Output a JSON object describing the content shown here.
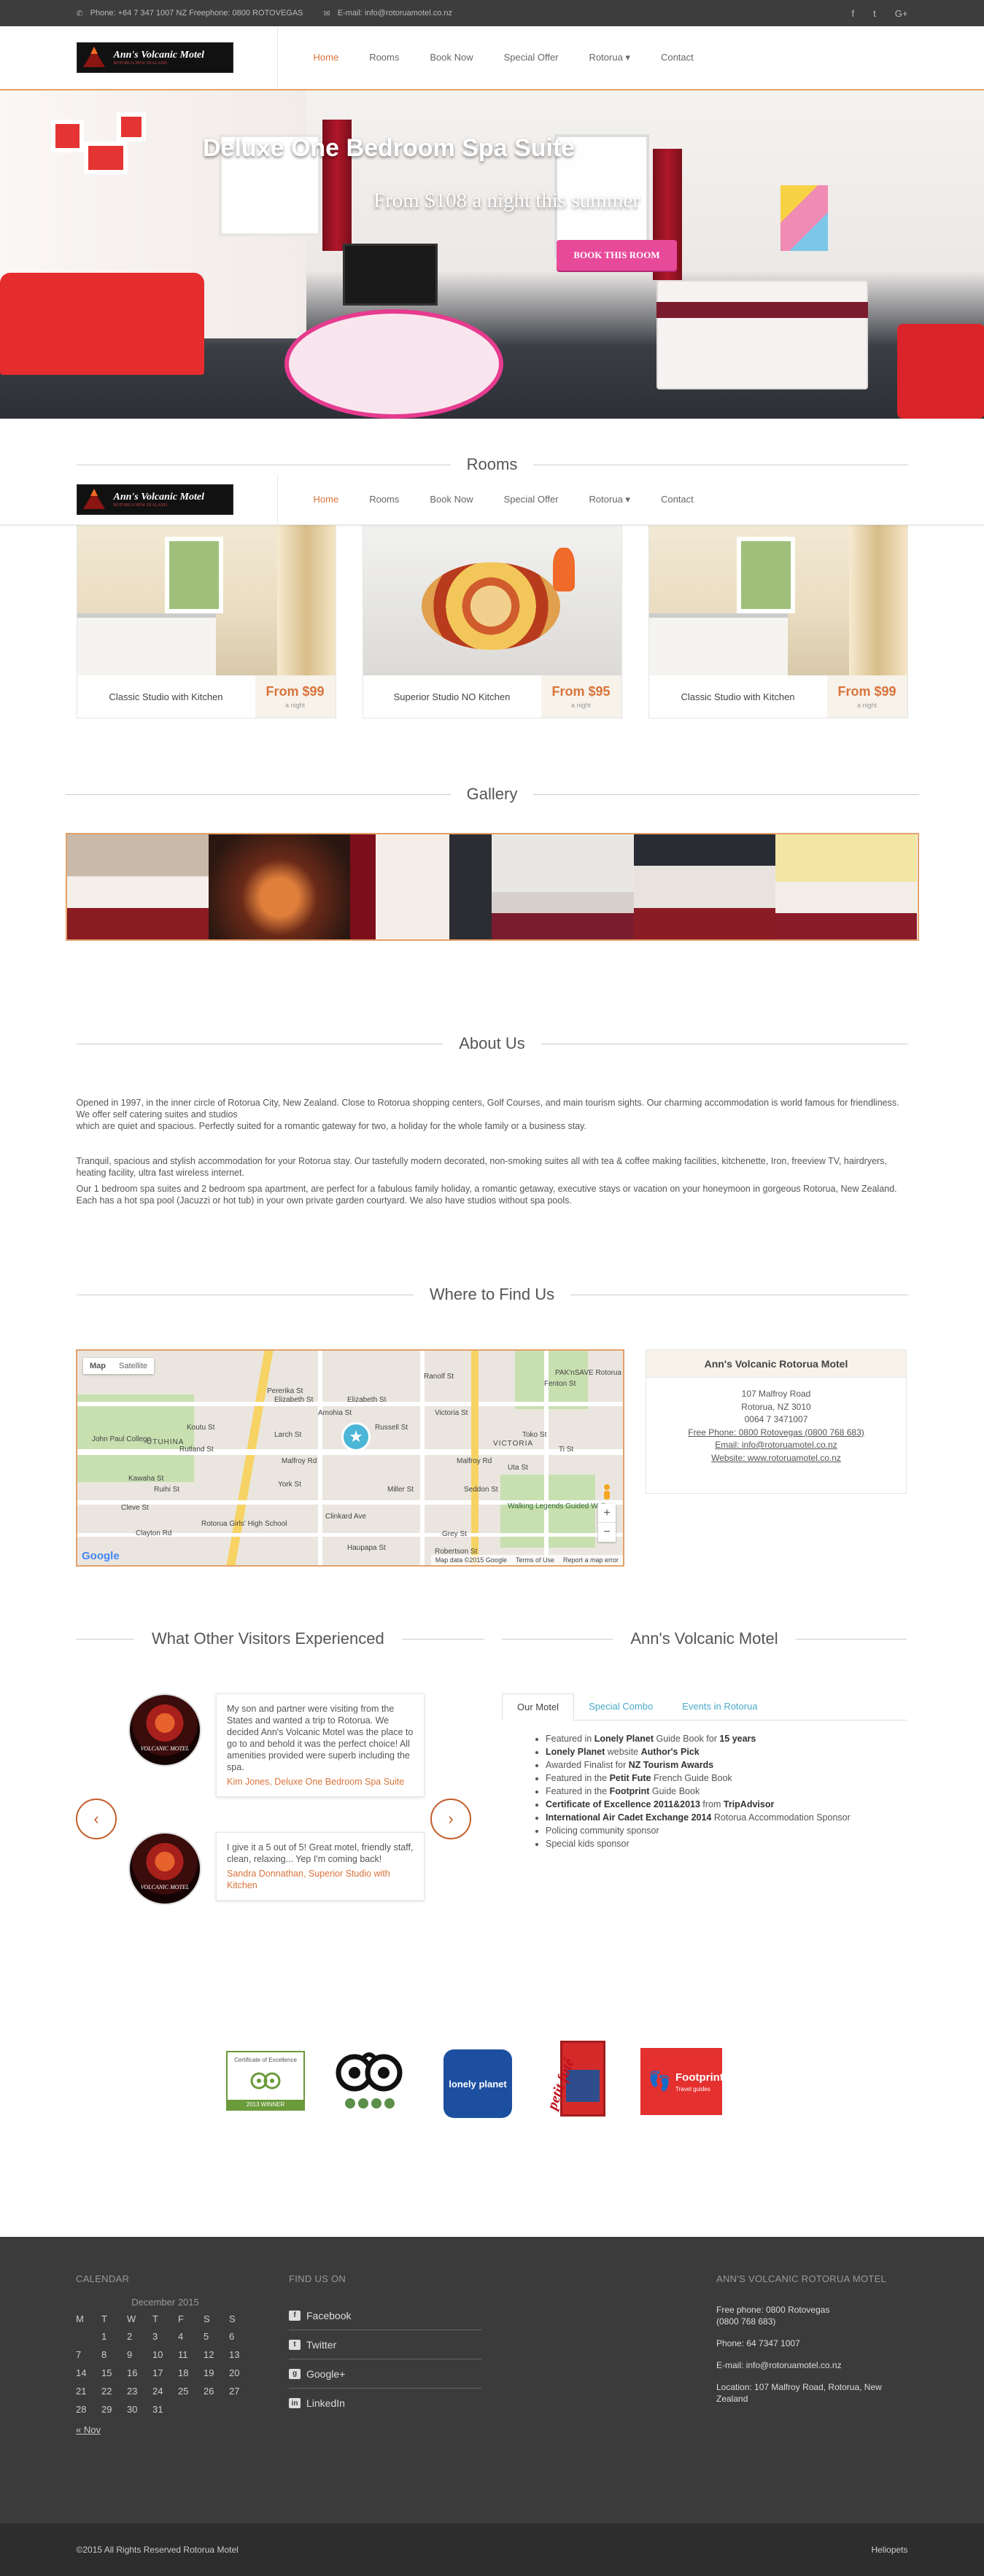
{
  "topbar": {
    "phone": "Phone: +64 7 347 1007 NZ Freephone: 0800 ROTOVEGAS",
    "email": "E-mail: info@rotoruamotel.co.nz",
    "social": [
      "f",
      "t",
      "G+"
    ]
  },
  "brand": {
    "name": "Ann's Volcanic Motel",
    "tagline": "ROTORUA NEW ZEALAND"
  },
  "nav": {
    "items": [
      "Home",
      "Rooms",
      "Book Now",
      "Special Offer",
      "Rotorua",
      "Contact"
    ],
    "dropdown_caret": "▾"
  },
  "hero": {
    "title": "Deluxe One Bedroom Spa Suite",
    "subtitle": "From $108 a night this summer",
    "button": "BOOK THIS ROOM"
  },
  "rooms": {
    "title": "Rooms",
    "cards": [
      {
        "name": "Classic Studio with Kitchen",
        "price": "From $99",
        "per": "a night"
      },
      {
        "name": "Superior Studio NO Kitchen",
        "price": "From $95",
        "per": "a night"
      },
      {
        "name": "Classic Studio with Kitchen",
        "price": "From $99",
        "per": "a night"
      }
    ]
  },
  "gallery": {
    "title": "Gallery"
  },
  "about": {
    "title": "About Us",
    "p1": "Opened in 1997, in the inner circle of Rotorua City, New Zealand. Close to Rotorua shopping centers, Golf Courses, and main tourism sights. Our charming accommodation is world famous for friendliness. We offer self catering suites and studios",
    "p1b": "which are quiet and spacious. Perfectly suited for a romantic gateway for two, a holiday for the whole family or a business stay.",
    "p2": "Tranquil, spacious and stylish accommodation for your Rotorua stay. Our tastefully modern decorated, non-smoking suites all with tea & coffee making facilities, kitchenette, Iron, freeview TV, hairdryers, heating facility, ultra fast wireless internet.",
    "p3": "Our 1 bedroom spa suites and 2 bedroom spa apartment, are perfect for a fabulous family holiday, a romantic getaway, executive stays or vacation on your honeymoon in gorgeous Rotorua, New Zealand. Each has a hot spa pool (Jacuzzi or hot tub) in your own private garden courtyard. We also have studios without spa pools."
  },
  "findus": {
    "title": "Where to Find Us",
    "map": {
      "type_map": "Map",
      "type_satellite": "Satellite",
      "labels": [
        "Pererika St",
        "Elizabeth St",
        "Elizabeth St",
        "Larch St",
        "Rutland St",
        "Malfroy Rd",
        "Malfroy Rd",
        "York St",
        "Clinkard Ave",
        "Seddon St",
        "Grey St",
        "Victoria St",
        "Haupapa St",
        "Ranolf St",
        "Amohia St",
        "Rotorua Girls' High School",
        "UTUHINA",
        "VICTORIA",
        "Walking Legends Guided Walks",
        "PAK'nSAVE Rotorua",
        "Koutu St",
        "Russell St",
        "Kawaha St",
        "John Paul College",
        "Ruihi St",
        "Robertson St",
        "Fenton St",
        "Toko St",
        "Ti St",
        "Miller St",
        "Uta St",
        "Cleve St",
        "Clayton Rd"
      ],
      "zoom_in": "+",
      "zoom_out": "−",
      "google": "Google",
      "footer": [
        "Map data ©2015 Google",
        "Terms of Use",
        "Report a map error"
      ]
    },
    "card": {
      "title": "Ann's Volcanic Rotorua Motel",
      "address1": "107 Malfroy Road",
      "address2": "Rotorua, NZ 3010",
      "phone": "0064 7 3471007",
      "freephone": "Free Phone: 0800 Rotovegas (0800 768 683)",
      "email": "Email: info@rotoruamotel.co.nz",
      "website": "Website: www.rotoruamotel.co.nz"
    }
  },
  "visitors": {
    "title": "What Other Visitors Experienced",
    "avatar_text": "VOLCANIC MOTEL",
    "testimonials": [
      {
        "text": "My son and partner were visiting from the States and wanted a trip to Rotorua. We decided Ann's Volcanic Motel was the place to go to and behold it was the perfect choice! All amenities provided were superb including the spa.",
        "author": "Kim Jones, Deluxe One Bedroom Spa Suite"
      },
      {
        "text": "I give it a 5 out of 5! Great motel, friendly staff, clean, relaxing... Yep I'm coming back!",
        "author": "Sandra Donnathan, Superior Studio with Kitchen"
      }
    ],
    "prev": "‹",
    "next": "›"
  },
  "motel_tabs": {
    "title": "Ann's Volcanic Motel",
    "tabs": [
      "Our Motel",
      "Special Combo",
      "Events in Rotorua"
    ],
    "items": [
      {
        "pre": "Featured in ",
        "bold": "Lonely Planet",
        "post": " Guide Book for ",
        "bold2": "15 years"
      },
      {
        "pre": "",
        "bold": "Lonely Planet",
        "post": " website ",
        "bold2": "Author's Pick"
      },
      {
        "pre": "Awarded Finalist for ",
        "bold": "NZ Tourism Awards",
        "post": "",
        "bold2": ""
      },
      {
        "pre": "Featured in the ",
        "bold": "Petit Fute",
        "post": " French Guide Book",
        "bold2": ""
      },
      {
        "pre": "Featured in the ",
        "bold": "Footprint",
        "post": " Guide Book",
        "bold2": ""
      },
      {
        "pre": "",
        "bold": "Certificate of Excellence 2011&2013",
        "post": " from ",
        "bold2": "TripAdvisor"
      },
      {
        "pre": "",
        "bold": "International Air Cadet Exchange 2014",
        "post": " Rotorua Accommodation Sponsor",
        "bold2": ""
      },
      {
        "pre": "Policing community sponsor",
        "bold": "",
        "post": "",
        "bold2": ""
      },
      {
        "pre": "Special kids sponsor",
        "bold": "",
        "post": "",
        "bold2": ""
      }
    ]
  },
  "badges": {
    "tripadvisor_cert": "Certificate of Excellence",
    "tripadvisor_cert_sub": "2013 WINNER",
    "lonely_planet": "lonely planet",
    "petit_fute": "petit futé",
    "footprint": "Footprint",
    "footprint_sub": "Travel guides"
  },
  "footer": {
    "calendar_title": "CALENDAR",
    "calendar_month": "December 2015",
    "weekdays": [
      "M",
      "T",
      "W",
      "T",
      "F",
      "S",
      "S"
    ],
    "weeks": [
      [
        "",
        "1",
        "2",
        "3",
        "4",
        "5",
        "6"
      ],
      [
        "7",
        "8",
        "9",
        "10",
        "11",
        "12",
        "13"
      ],
      [
        "14",
        "15",
        "16",
        "17",
        "18",
        "19",
        "20"
      ],
      [
        "21",
        "22",
        "23",
        "24",
        "25",
        "26",
        "27"
      ],
      [
        "28",
        "29",
        "30",
        "31",
        "",
        "",
        ""
      ]
    ],
    "prev_month": "« Nov",
    "find_title": "FIND US ON",
    "social": [
      "Facebook",
      "Twitter",
      "Google+",
      "LinkedIn"
    ],
    "info_title": "ANN'S VOLCANIC ROTORUA MOTEL",
    "free_phone": "Free phone: 0800 Rotovegas",
    "free_phone2": "(0800 768 683)",
    "phone": "Phone: 64 7347 1007",
    "email": "E-mail: info@rotoruamotel.co.nz",
    "location": "Location: 107 Malfroy Road, Rotorua, New Zealand",
    "copyright": "©2015 All Rights Reserved Rotorua Motel",
    "credit": "Heliopets"
  }
}
